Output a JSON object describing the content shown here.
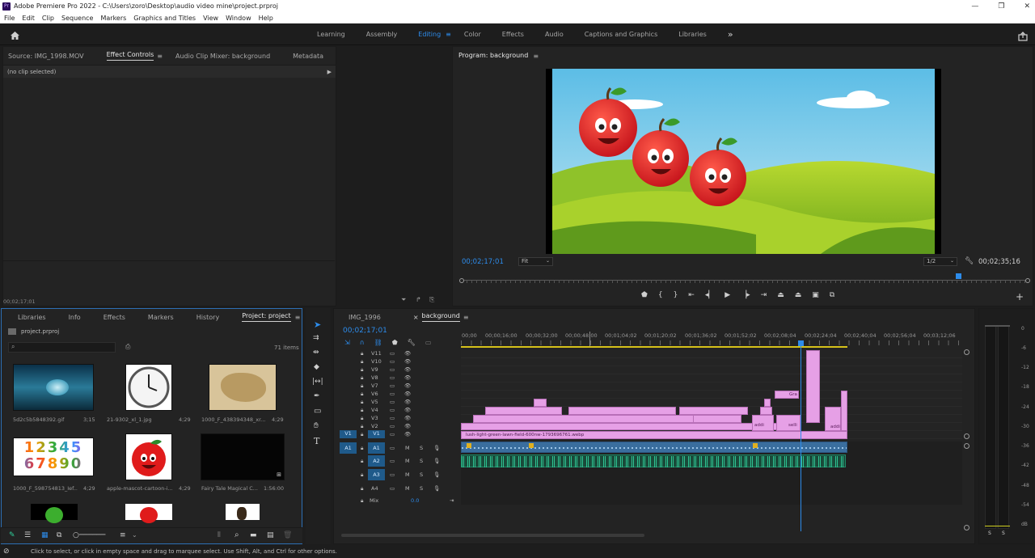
{
  "window": {
    "title": "Adobe Premiere Pro 2022 - C:\\Users\\zoro\\Desktop\\audio video mine\\project.prproj",
    "app_badge": "Pr",
    "minimize": "—",
    "maximize": "❐",
    "close": "✕"
  },
  "menu": [
    "File",
    "Edit",
    "Clip",
    "Sequence",
    "Markers",
    "Graphics and Titles",
    "View",
    "Window",
    "Help"
  ],
  "workspaces": {
    "tabs": [
      "Learning",
      "Assembly",
      "Editing",
      "Color",
      "Effects",
      "Audio",
      "Captions and Graphics",
      "Libraries"
    ],
    "active": "Editing",
    "more": "»"
  },
  "source_panel": {
    "tabs": [
      "Source: IMG_1998.MOV",
      "Effect Controls",
      "Audio Clip Mixer: background",
      "Metadata"
    ],
    "active_tab": "Effect Controls",
    "no_clip": "(no clip selected)",
    "timecode": "00;02;17;01"
  },
  "program": {
    "title": "Program: background",
    "timecode": "00;02;17;01",
    "fit": "Fit",
    "resolution": "1/2",
    "duration": "00;02;35;16"
  },
  "project_panel": {
    "tabs": [
      "Libraries",
      "Info",
      "Effects",
      "Markers",
      "History",
      "Project: project"
    ],
    "active_tab": "Project: project",
    "file": "project.prproj",
    "items_count": "71 items",
    "search_placeholder": "",
    "items": [
      {
        "name": "5d2c5b5848392.gif",
        "dur": "3;15"
      },
      {
        "name": "21-9302_xl_1.jpg",
        "dur": "4;29"
      },
      {
        "name": "1000_F_438394348_xr...",
        "dur": "4;29"
      },
      {
        "name": "1000_F_598754813_Ief...",
        "dur": "4;29"
      },
      {
        "name": "apple-mascot-cartoon-i...",
        "dur": "4;29"
      },
      {
        "name": "Fairy Tale Magical C...",
        "dur": "1:56:00"
      }
    ],
    "numbers_row1": "12345",
    "numbers_row2": "67890"
  },
  "timeline": {
    "tabs": [
      "IMG_1996",
      "background"
    ],
    "active_tab": "background",
    "timecode": "00;02;17;01",
    "ruler": [
      "00;00",
      "00;00;16;00",
      "00;00;32;00",
      "00;00;48;00",
      "00;01;04;02",
      "00;01;20;02",
      "00;01;36;02",
      "00;01;52;02",
      "00;02;08;04",
      "00;02;24;04",
      "00;02;40;04",
      "00;02;56;04",
      "00;03;12;06"
    ],
    "video_tracks": [
      "V11",
      "V10",
      "V9",
      "V8",
      "V7",
      "V6",
      "V5",
      "V4",
      "V3",
      "V2",
      "V1"
    ],
    "audio_tracks": [
      "A1",
      "A2",
      "A3",
      "A4"
    ],
    "mix_label": "Mix",
    "mix_value": "0.0",
    "src_v": "V1",
    "src_a": "A1",
    "v1_clip": "lush-light-green-lawn-field-600nw-1793696761.webp",
    "clip_labels": [
      "Gra",
      "addi",
      "selli",
      "addi"
    ],
    "mute": "M",
    "solo": "S"
  },
  "meters": {
    "labels": [
      "0",
      "-6",
      "-12",
      "-18",
      "-24",
      "-30",
      "-36",
      "-42",
      "-48",
      "-54",
      "dB"
    ],
    "solo_left": "S",
    "solo_right": "S"
  },
  "status": "Click to select, or click in empty space and drag to marquee select. Use Shift, Alt, and Ctrl for other options.",
  "colors": {
    "accent": "#2d8ceb",
    "clip": "#e6a0e6",
    "audio": "#2fd19c",
    "playhead": "#2d8ceb"
  },
  "icons": [
    "home-icon",
    "share-icon",
    "wrench-icon",
    "play-icon",
    "selection-tool-icon",
    "razor-tool-icon",
    "hand-tool-icon",
    "type-tool-icon",
    "pen-tool-icon",
    "search-icon",
    "folder-icon"
  ]
}
